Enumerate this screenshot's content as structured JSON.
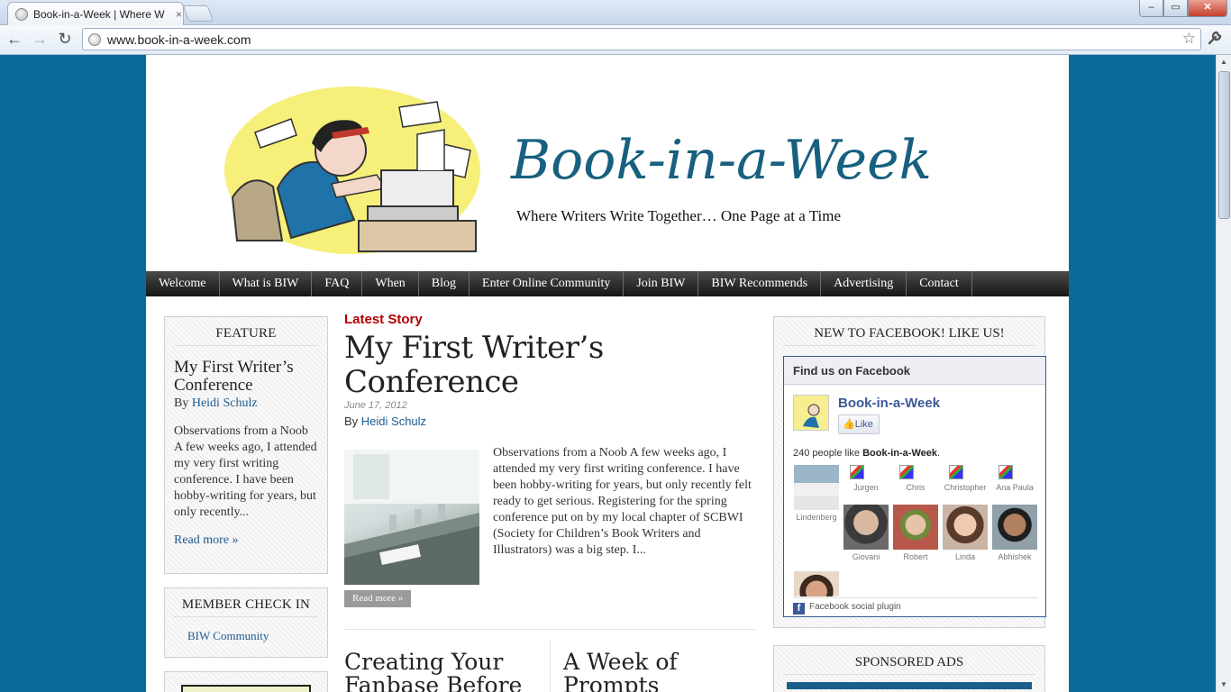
{
  "browser": {
    "tab_title": "Book-in-a-Week | Where W",
    "tab_close": "×",
    "url": "www.book-in-a-week.com",
    "window_controls": {
      "minimize": "–",
      "maximize": "▭",
      "close": "✕"
    },
    "nav": {
      "back": "←",
      "forward": "→",
      "reload": "↻",
      "star": "☆",
      "wrench": "🔧"
    }
  },
  "site": {
    "logo_text": "Book-in-a-Week",
    "tagline": "Where Writers Write Together… One Page at a Time",
    "accent_color": "#17607f",
    "background_color": "#0b6a9c"
  },
  "nav": [
    "Welcome",
    "What is BIW",
    "FAQ",
    "When",
    "Blog",
    "Enter Online Community",
    "Join BIW",
    "BIW Recommends",
    "Advertising",
    "Contact"
  ],
  "feature": {
    "heading": "FEATURE",
    "title": "My First Writer’s Conference",
    "by_prefix": "By",
    "author": "Heidi Schulz",
    "excerpt": "Observations from a Noob A few weeks ago, I attended my very first writing conference. I have been hobby-writing for years, but only recently...",
    "read_more": "Read more »"
  },
  "member": {
    "heading": "MEMBER CHECK IN",
    "link": "BIW Community"
  },
  "latest": {
    "label": "Latest Story",
    "title": "My First Writer’s Conference",
    "date": "June 17, 2012",
    "by_prefix": "By",
    "author": "Heidi Schulz",
    "excerpt": "Observations from a Noob A few weeks ago, I attended my very first writing conference. I have been hobby-writing for years, but only recently felt ready to get serious. Registering for the spring conference put on by my local chapter of SCBWI (Society for Children’s Book Writers and Illustrators) was a big step. I...",
    "read_more": "Read more »"
  },
  "more_stories": [
    {
      "title": "Creating Your Fanbase Before"
    },
    {
      "title": "A Week of Prompts"
    }
  ],
  "facebook": {
    "heading": "NEW TO FACEBOOK! LIKE US!",
    "box_title": "Find us on Facebook",
    "page_name": "Book-in-a-Week",
    "like_label": "Like",
    "count_text": "240 people like",
    "count_page": "Book-in-a-Week",
    "count_suffix": ".",
    "faces": [
      "Lindenberg",
      "Jurgen",
      "Chris",
      "Christopher",
      "Ana Paula",
      "Giovani",
      "Robert",
      "Linda",
      "Abhishek"
    ],
    "footer": "Facebook social plugin"
  },
  "sponsored": {
    "heading": "SPONSORED ADS"
  }
}
